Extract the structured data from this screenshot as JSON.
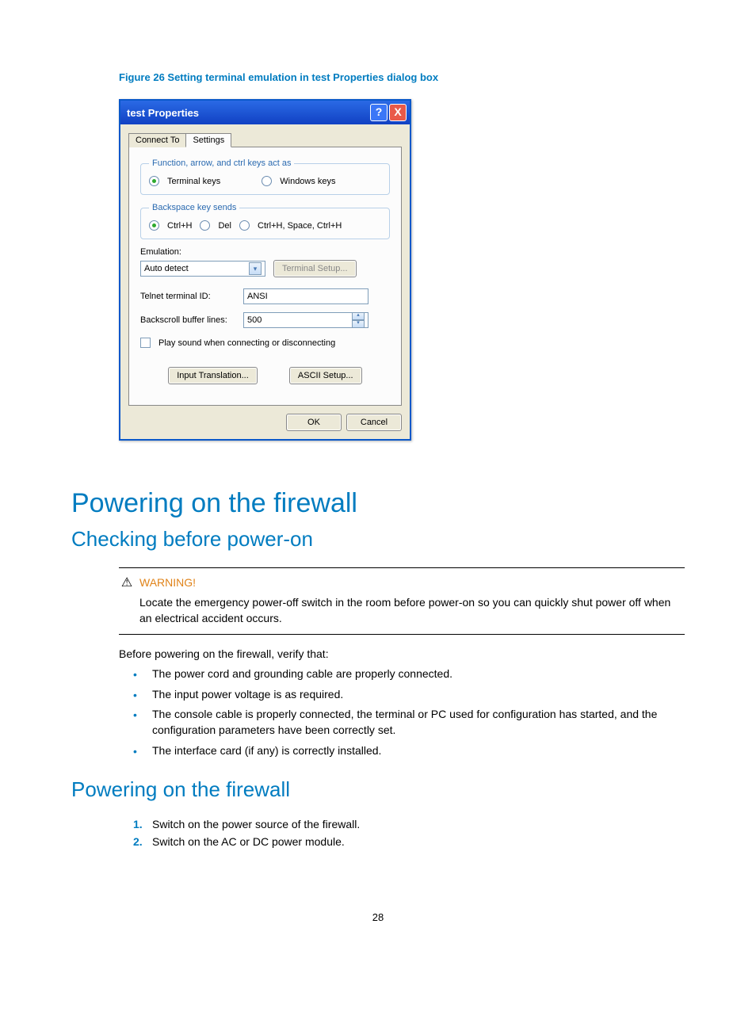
{
  "figure_caption": "Figure 26 Setting terminal emulation in test Properties dialog box",
  "dialog": {
    "title": "test Properties",
    "help": "?",
    "close": "X",
    "tabs": [
      "Connect To",
      "Settings"
    ],
    "group1": {
      "legend": "Function, arrow, and ctrl keys act as",
      "opt1": "Terminal keys",
      "opt2": "Windows keys"
    },
    "group2": {
      "legend": "Backspace key sends",
      "opt1": "Ctrl+H",
      "opt2": "Del",
      "opt3": "Ctrl+H, Space, Ctrl+H"
    },
    "emulation_label": "Emulation:",
    "emulation_value": "Auto detect",
    "terminal_setup_btn": "Terminal Setup...",
    "telnet_label": "Telnet terminal ID:",
    "telnet_value": "ANSI",
    "backscroll_label": "Backscroll buffer lines:",
    "backscroll_value": "500",
    "play_sound": "Play sound when connecting or disconnecting",
    "input_translation_btn": "Input Translation...",
    "ascii_setup_btn": "ASCII Setup...",
    "ok_btn": "OK",
    "cancel_btn": "Cancel"
  },
  "h1": "Powering on the firewall",
  "h2a": "Checking before power-on",
  "warning_label": "WARNING!",
  "warning_text": "Locate the emergency power-off switch in the room before power-on so you can quickly shut power off when an electrical accident occurs.",
  "before_text": "Before powering on the firewall, verify that:",
  "bullets": [
    "The power cord and grounding cable are properly connected.",
    "The input power voltage is as required.",
    "The console cable is properly connected, the terminal or PC used for configuration has started, and the configuration parameters have been correctly set.",
    "The interface card (if any) is correctly installed."
  ],
  "h2b": "Powering on the firewall",
  "steps": [
    "Switch on the power source of the firewall.",
    "Switch on the AC or DC power module."
  ],
  "page_number": "28"
}
